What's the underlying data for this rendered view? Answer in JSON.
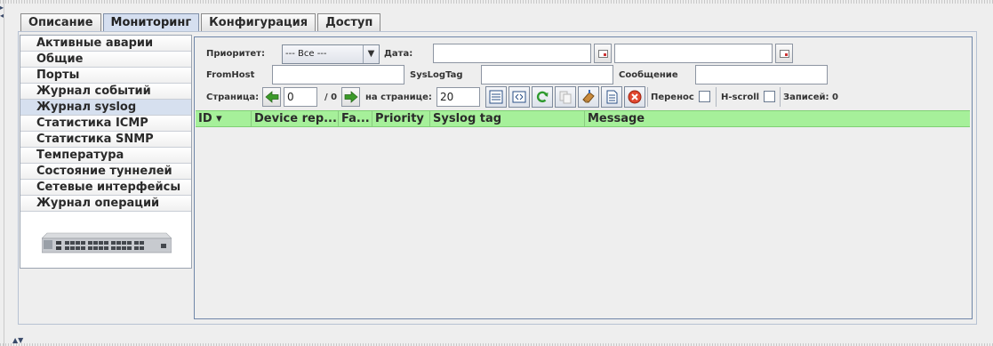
{
  "tabs": [
    {
      "label": "Описание"
    },
    {
      "label": "Мониторинг"
    },
    {
      "label": "Конфигурация"
    },
    {
      "label": "Доступ"
    }
  ],
  "sidebar": {
    "items": [
      {
        "label": "Активные аварии"
      },
      {
        "label": "Общие"
      },
      {
        "label": "Порты"
      },
      {
        "label": "Журнал событий"
      },
      {
        "label": "Журнал syslog"
      },
      {
        "label": "Статистика ICMP"
      },
      {
        "label": "Статистика SNMP"
      },
      {
        "label": "Температура"
      },
      {
        "label": "Состояние туннелей"
      },
      {
        "label": "Сетевые интерфейсы"
      },
      {
        "label": "Журнал операций"
      }
    ]
  },
  "filters": {
    "priority_label": "Приоритет:",
    "priority_value": "--- Все ---",
    "date_label": "Дата:",
    "date_from": "",
    "date_to": "",
    "fromhost_label": "FromHost",
    "fromhost_value": "",
    "syslogtag_label": "SysLogTag",
    "syslogtag_value": "",
    "message_label": "Сообщение",
    "message_value": ""
  },
  "pager": {
    "page_label": "Страница:",
    "page_value": "0",
    "total": "/ 0",
    "per_page_label": "на странице:",
    "per_page_value": "20",
    "wrap_label": "Перенос",
    "hscroll_label": "H-scroll",
    "records": "Записей: 0"
  },
  "table": {
    "columns": [
      {
        "label": "ID ▾"
      },
      {
        "label": "Device rep..."
      },
      {
        "label": "Fa..."
      },
      {
        "label": "Priority"
      },
      {
        "label": "Syslog tag"
      },
      {
        "label": "Message"
      }
    ]
  },
  "colors": {
    "header_green": "#a6f09a",
    "active_tab": "#d5dff0"
  }
}
